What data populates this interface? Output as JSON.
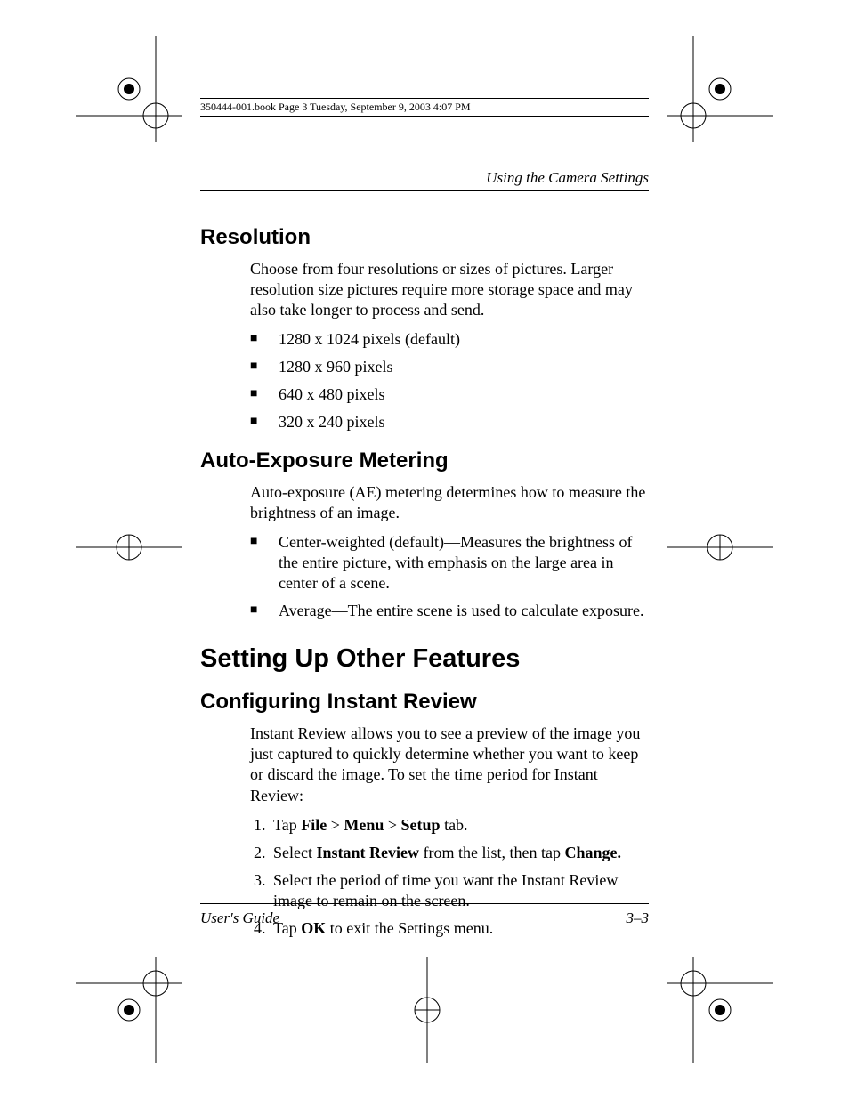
{
  "meta_header": "350444-001.book  Page 3  Tuesday, September 9, 2003  4:07 PM",
  "running_head": "Using the Camera Settings",
  "resolution": {
    "heading": "Resolution",
    "intro": "Choose from four resolutions or sizes of pictures. Larger resolution size pictures require more storage space and may also take longer to process and send.",
    "items": [
      "1280 x 1024 pixels (default)",
      "1280 x 960 pixels",
      "640 x 480 pixels",
      "320 x 240 pixels"
    ]
  },
  "ae": {
    "heading": "Auto-Exposure Metering",
    "intro": "Auto-exposure (AE) metering determines how to measure the brightness of an image.",
    "items": [
      "Center-weighted (default)—Measures the brightness of the entire picture, with emphasis on the large area in center of a scene.",
      "Average—The entire scene is used to calculate exposure."
    ]
  },
  "other": {
    "heading": "Setting Up Other Features"
  },
  "instant": {
    "heading": "Configuring Instant Review",
    "intro": "Instant Review allows you to see a preview of the image you just captured to quickly determine whether you want to keep or discard the image. To set the time period for Instant Review:",
    "steps_html": [
      "Tap <strong>File</strong> > <strong>Menu</strong> > <strong>Setup</strong> tab.",
      "Select <strong>Instant Review</strong> from the list, then tap <strong>Change.</strong>",
      "Select the period of time you want the Instant Review image to remain on the screen.",
      "Tap <strong>OK</strong> to exit the Settings menu."
    ]
  },
  "footer": {
    "left": "User's Guide",
    "right": "3–3"
  }
}
